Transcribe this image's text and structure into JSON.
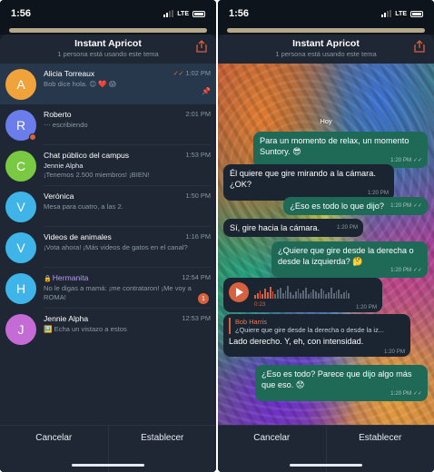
{
  "status": {
    "time": "1:56",
    "network": "LTE"
  },
  "sheet": {
    "title": "Instant Apricot",
    "subtitle": "1 persona está usando este tema"
  },
  "chats": [
    {
      "initial": "A",
      "color": "#f0a23b",
      "name": "Alicia Torreaux",
      "time": "1:02 PM",
      "message": "Bob dice hola. 😊 ❤️ 😱",
      "read": true,
      "pinned": true
    },
    {
      "initial": "R",
      "color": "#6a7dea",
      "name": "Roberto",
      "time": "2:01 PM",
      "message": "escribiendo",
      "typing": true,
      "online": true
    },
    {
      "initial": "C",
      "color": "#7ac943",
      "name": "Chat público del campus",
      "time": "1:53 PM",
      "sender": "Jennie Alpha",
      "message": "¡Tenemos 2.500 miembros! ¡BIEN!"
    },
    {
      "initial": "V",
      "color": "#3fb4e8",
      "name": "Verónica",
      "time": "1:50 PM",
      "message": "Mesa para cuatro, a las 2."
    },
    {
      "initial": "V",
      "color": "#3fb4e8",
      "name": "Videos de animales",
      "time": "1:16 PM",
      "message": "¡Vota ahora! ¡Más videos de gatos en el canal?"
    },
    {
      "initial": "H",
      "color": "#3fb4e8",
      "name": "Hermanita",
      "time": "12:54 PM",
      "message": "No le digas a mamá: ¡me contrataron! ¡Me voy a ROMA!",
      "secret": true,
      "unread": "1"
    },
    {
      "initial": "J",
      "color": "#c56bd6",
      "name": "Jennie Alpha",
      "time": "12:53 PM",
      "message": "Echa un vistazo a estos",
      "photo": true
    }
  ],
  "actions": {
    "cancel": "Cancelar",
    "set": "Establecer"
  },
  "conversation": {
    "date": "Hoy",
    "messages": [
      {
        "id": "m1",
        "dir": "out",
        "text": "Para un momento de relax, un momento Suntory. 😎",
        "time": "1:20 PM"
      },
      {
        "id": "m2",
        "dir": "in",
        "text": "Él quiere que gire mirando a la cámara. ¿OK?",
        "time": "1:20 PM"
      },
      {
        "id": "m3",
        "dir": "out",
        "text": "¿Eso es todo lo que dijo?",
        "time": "1:20 PM"
      },
      {
        "id": "m4",
        "dir": "in",
        "text": "Sí, gire hacia la cámara.",
        "time": "1:20 PM"
      },
      {
        "id": "m5",
        "dir": "out",
        "text": "¿Quiere que gire desde la derecha o desde la izquierda? 🤔",
        "time": "1:20 PM"
      },
      {
        "id": "m7",
        "dir": "out",
        "text": "¿Eso es todo? Parece que dijo algo más que eso. 😟",
        "time": "1:20 PM"
      }
    ],
    "voice": {
      "duration": "0:23",
      "time": "1:20 PM",
      "progress": 0.2
    },
    "reply": {
      "quote_name": "Bob Harris",
      "quote_text": "¿Quiere que gire desde la derecha o desde la iz...",
      "text": "Lado derecho. Y, eh, con intensidad.",
      "time": "1:20 PM"
    }
  },
  "colors": {
    "accent": "#d7603f",
    "outgoing_bubble": "#1f6a57",
    "incoming_bubble": "#1b2531",
    "background": "#1e2733"
  }
}
